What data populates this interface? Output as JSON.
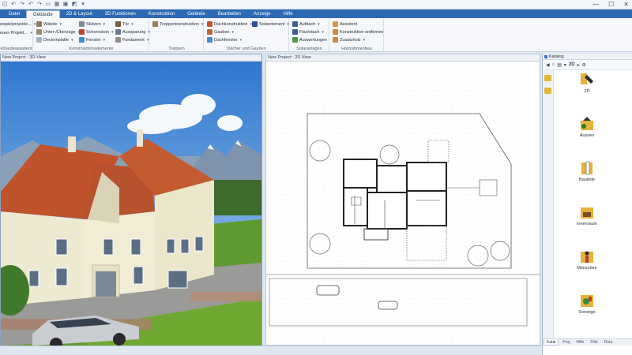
{
  "quick_access": [
    "◰",
    "↶",
    "↷",
    "↶",
    "↷",
    "▭",
    "▦",
    "▣",
    "◩",
    "▾"
  ],
  "window_controls": {
    "minimize": "—",
    "maximize": "☐",
    "close": "✕"
  },
  "tabs": [
    {
      "label": "Datei"
    },
    {
      "label": "Gebäude"
    },
    {
      "label": "2D & Layout"
    },
    {
      "label": "3D Funktionen"
    },
    {
      "label": "Konstruktion"
    },
    {
      "label": "Gelände"
    },
    {
      "label": "Bearbeiten"
    },
    {
      "label": "Anzeige"
    },
    {
      "label": "Hilfe"
    }
  ],
  "active_tab": "Gebäude",
  "ribbon": {
    "projects": {
      "items": [
        "eispielprojekte...",
        "eues Projekt..."
      ],
      "caption": "ebäudeassistent"
    },
    "elements": {
      "items": [
        "Wände",
        "Stützen",
        "Tür",
        "Unter-/Überzüge",
        "Schornstein",
        "Aussparung",
        "Deckenplatte",
        "Fenster",
        "Fundament"
      ],
      "caption": "Konstruktionselemente"
    },
    "stairs": {
      "items": [
        "Treppenkonstruktion"
      ],
      "caption": "Treppen"
    },
    "roofs": {
      "items": [
        "Dachkonstruktion",
        "Solarelement",
        "Gauben",
        "Dachfenster"
      ],
      "caption": "Dächer und Gauben"
    },
    "solar": {
      "items": [
        "Aufdach",
        "Flachdach",
        "Auswertungen"
      ],
      "caption": "Solaranlagen"
    },
    "timber": {
      "items": [
        "Assistent",
        "Konstruktion entfernen",
        "Zusatzholz"
      ],
      "caption": "Holzrahmenbau"
    }
  },
  "panes": {
    "view3d_title": "New Project : 3D-View",
    "view2d_title": "New Project : 2D View"
  },
  "catalog": {
    "title": "Katalog",
    "toolbar_label": "2D",
    "items": [
      {
        "label": "2D",
        "icon": "wrench-2d-icon"
      },
      {
        "label": "Aussen",
        "icon": "exterior-icon"
      },
      {
        "label": "Bauteile",
        "icon": "components-icon"
      },
      {
        "label": "Innenraum",
        "icon": "interior-icon"
      },
      {
        "label": "Menschen",
        "icon": "people-icon"
      },
      {
        "label": "Sonstige",
        "icon": "misc-icon"
      }
    ],
    "tabs": [
      "Katal",
      "Proj",
      "Hilfe",
      "Filte",
      "Rota"
    ]
  },
  "colors": {
    "ribbon_tabs": "#2d6ab3",
    "sky": "#4f8fd6",
    "roof": "#c0522c",
    "grass": "#5e9a2f"
  }
}
